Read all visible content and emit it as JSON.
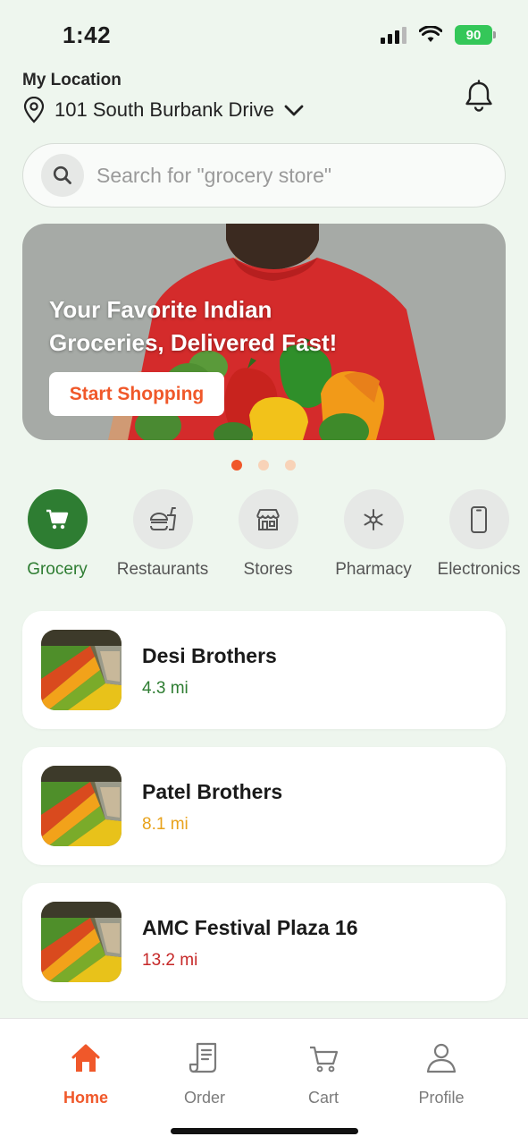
{
  "status_bar": {
    "time": "1:42",
    "battery": "90"
  },
  "header": {
    "location_label": "My Location",
    "address": "101 South Burbank Drive",
    "icons": [
      "location-pin-icon",
      "chevron-down-icon",
      "bell-icon"
    ]
  },
  "search": {
    "placeholder": "Search for \"grocery store\"",
    "value": ""
  },
  "banner": {
    "title": "Your Favorite Indian Groceries, Delivered Fast!",
    "button_label": "Start Shopping",
    "slide_count": 3,
    "active_slide": 1
  },
  "categories": [
    {
      "label": "Grocery",
      "icon": "cart-icon",
      "active": true
    },
    {
      "label": "Restaurants",
      "icon": "burger-drink-icon",
      "active": false
    },
    {
      "label": "Stores",
      "icon": "storefront-icon",
      "active": false
    },
    {
      "label": "Pharmacy",
      "icon": "pharmacy-icon",
      "active": false
    },
    {
      "label": "Electronics",
      "icon": "phone-icon",
      "active": false
    }
  ],
  "stores": [
    {
      "name": "Desi Brothers",
      "distance": "4.3 mi",
      "distance_color": "#2e7d32"
    },
    {
      "name": "Patel Brothers",
      "distance": "8.1 mi",
      "distance_color": "#e8a21b"
    },
    {
      "name": "AMC Festival Plaza 16",
      "distance": "13.2 mi",
      "distance_color": "#c62828"
    }
  ],
  "bottom_nav": [
    {
      "label": "Home",
      "icon": "home-icon",
      "active": true
    },
    {
      "label": "Order",
      "icon": "receipt-icon",
      "active": false
    },
    {
      "label": "Cart",
      "icon": "cart-outline-icon",
      "active": false
    },
    {
      "label": "Profile",
      "icon": "user-icon",
      "active": false
    }
  ],
  "colors": {
    "accent": "#f0582a",
    "primary_green": "#2e7d32",
    "background": "#eef6ee"
  }
}
